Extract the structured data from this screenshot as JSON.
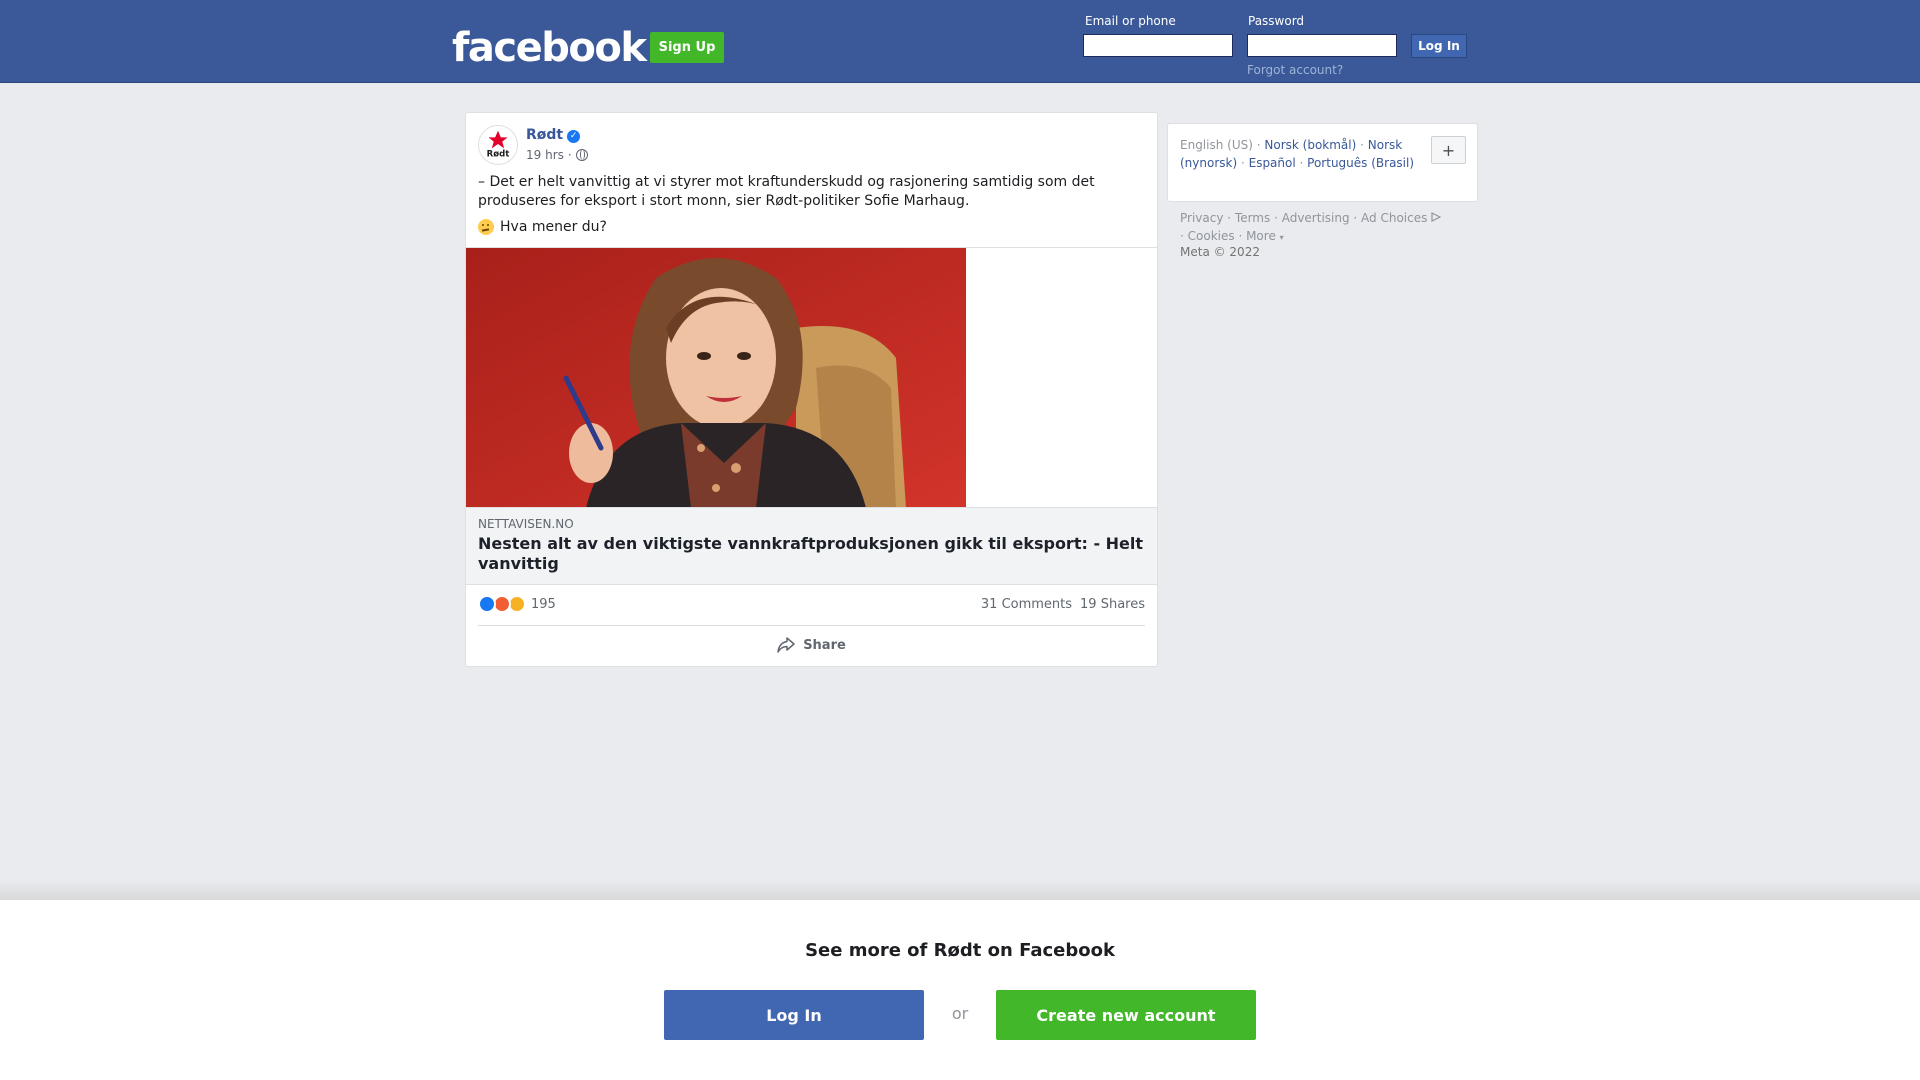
{
  "header": {
    "logo": "facebook",
    "signup_label": "Sign Up",
    "email_label": "Email or phone",
    "email_value": "",
    "password_label": "Password",
    "password_value": "",
    "login_label": "Log In",
    "forgot_label": "Forgot account?"
  },
  "post": {
    "page_name": "Rødt",
    "avatar_text": "Rødt",
    "time": "19 hrs",
    "time_separator": "·",
    "text": "– Det er helt vanvittig at vi styrer mot kraftunderskudd og rasjonering samtidig som det produseres for eksport i stort monn, sier Rødt-politiker Sofie Marhaug.",
    "question": "Hva mener du?",
    "link": {
      "domain": "NETTAVISEN.NO",
      "title": "Nesten alt av den viktigste vannkraftproduksjonen gikk til eksport: - Helt vanvittig"
    },
    "reactions_count": "195",
    "comments": "31 Comments",
    "shares": "19 Shares",
    "share_label": "Share"
  },
  "sidebar": {
    "languages": {
      "current": "English (US)",
      "options": [
        "Norsk (bokmål)",
        "Norsk (nynorsk)",
        "Español",
        "Português (Brasil)"
      ]
    },
    "add_language": "+",
    "footer_links": [
      "Privacy",
      "Terms",
      "Advertising",
      "Ad Choices",
      "Cookies",
      "More"
    ],
    "separator": "·",
    "copyright": "Meta © 2022"
  },
  "bottom": {
    "title": "See more of Rødt on Facebook",
    "login_label": "Log In",
    "or_label": "or",
    "create_label": "Create new account"
  },
  "colors": {
    "brand_blue": "#3b5998",
    "button_blue": "#4267b2",
    "green": "#42b72a",
    "link": "#385898"
  }
}
